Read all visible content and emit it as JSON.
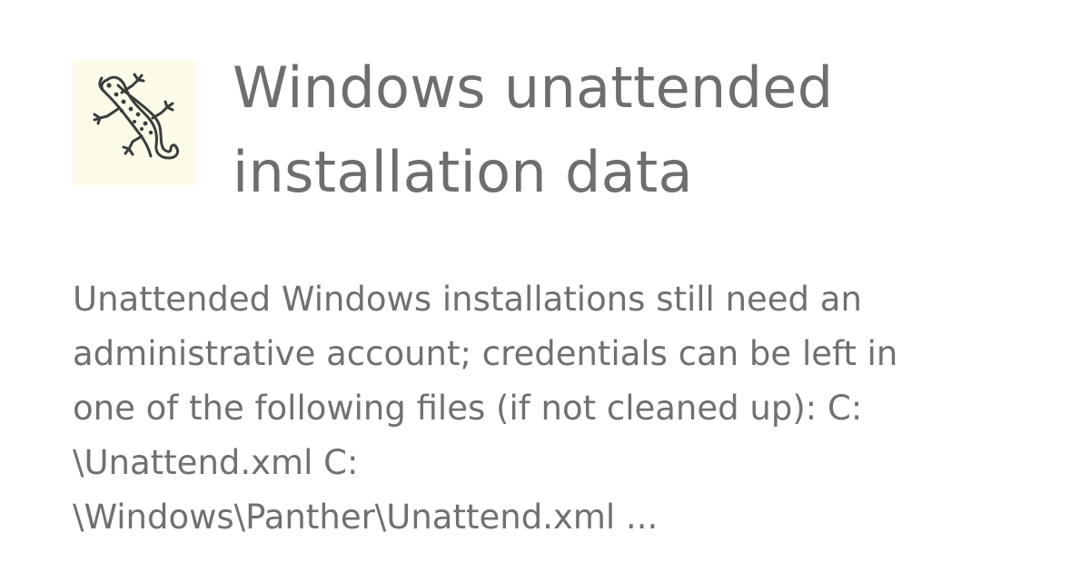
{
  "header": {
    "logo_icon": "gecko-icon",
    "logo_background": "#fdfcea",
    "title_line1": "Windows unattended",
    "title_line2": "installation data"
  },
  "description": {
    "line1": "Unattended Windows installations still need an",
    "line2": "administrative account; credentials can be left in",
    "line3": "one of the following files (if not cleaned up): C:",
    "line4": "\\Unattend.xml C:",
    "line5": "\\Windows\\Panther\\Unattend.xml ..."
  },
  "colors": {
    "text": "#6e6e6e",
    "background": "#ffffff"
  }
}
